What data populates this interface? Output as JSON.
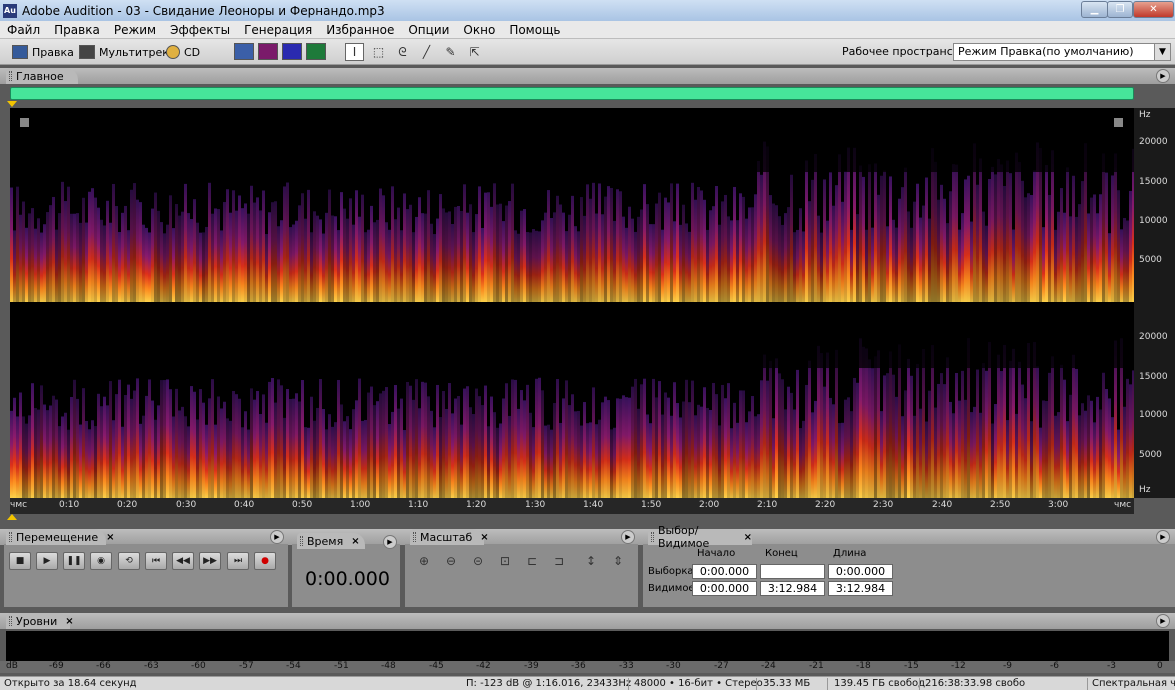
{
  "window": {
    "title": "Adobe Audition - 03 - Свидание Леоноры и Фернандо.mp3",
    "app_icon": "Au"
  },
  "menu": [
    "Файл",
    "Правка",
    "Режим",
    "Эффекты",
    "Генерация",
    "Избранное",
    "Опции",
    "Окно",
    "Помощь"
  ],
  "toolbar": {
    "edit_label": "Правка",
    "multitrack_label": "Мультитрек",
    "cd_label": "CD",
    "workspace_label": "Рабочее пространство:",
    "workspace_value": "Режим Правка(по умолчанию)"
  },
  "main_panel": {
    "tab": "Главное"
  },
  "hz_ticks": [
    "Hz",
    "20000",
    "15000",
    "10000",
    "5000",
    "20000",
    "15000",
    "10000",
    "5000",
    "Hz"
  ],
  "time_ticks": [
    "чмс",
    "0:10",
    "0:20",
    "0:30",
    "0:40",
    "0:50",
    "1:00",
    "1:10",
    "1:20",
    "1:30",
    "1:40",
    "1:50",
    "2:00",
    "2:10",
    "2:20",
    "2:30",
    "2:40",
    "2:50",
    "3:00",
    "чмс"
  ],
  "transport": {
    "tab": "Перемещение"
  },
  "time": {
    "tab": "Время",
    "value": "0:00.000"
  },
  "zoom": {
    "tab": "Масштаб"
  },
  "selection": {
    "tab": "Выбор/Видимое",
    "col_start": "Начало",
    "col_end": "Конец",
    "col_length": "Длина",
    "row_selection": "Выборка",
    "row_view": "Видимое",
    "sel_start": "0:00.000",
    "sel_end": "",
    "sel_length": "0:00.000",
    "view_start": "0:00.000",
    "view_end": "3:12.984",
    "view_length": "3:12.984"
  },
  "levels": {
    "tab": "Уровни"
  },
  "db_ticks": [
    "dB",
    "-69",
    "-66",
    "-63",
    "-60",
    "-57",
    "-54",
    "-51",
    "-48",
    "-45",
    "-42",
    "-39",
    "-36",
    "-33",
    "-30",
    "-27",
    "-24",
    "-21",
    "-18",
    "-15",
    "-12",
    "-9",
    "-6",
    "-3",
    "0"
  ],
  "status": {
    "opened": "Открыто за 18.64 секунд",
    "cursor": "П: -123 dB @   1:16.016, 23433Hz",
    "format": "48000 • 16-бит • Стерео",
    "size": "35.33 МБ",
    "free": "139.45 ГБ свобод",
    "free_time": "216:38:33.98 свобо",
    "view_mode": "Спектральная ч"
  },
  "colors": {
    "overview": "#46e59a",
    "spectrum_hot": "#ffd34a",
    "spectrum_mid": "#e0301a",
    "spectrum_cool": "#3a1260"
  }
}
